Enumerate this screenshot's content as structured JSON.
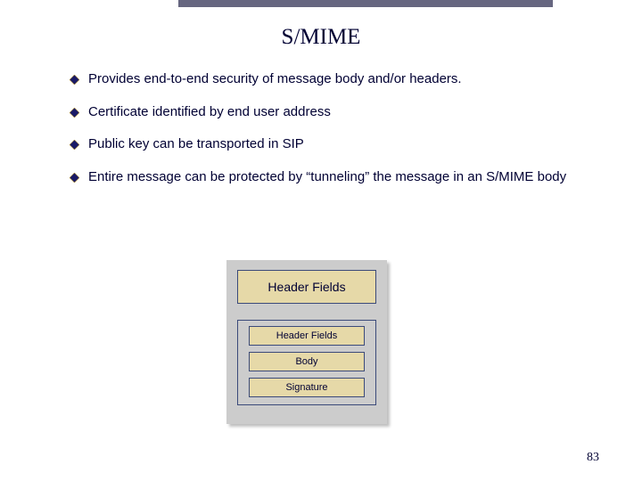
{
  "slide": {
    "title": "S/MIME",
    "bullets": [
      "Provides end-to-end security of message body and/or headers.",
      "Certificate identified by end user address",
      "Public key can be transported in SIP",
      "Entire message can be protected by “tunneling” the message in an S/MIME body"
    ],
    "diagram": {
      "outer": "Header Fields",
      "inner": [
        "Header Fields",
        "Body",
        "Signature"
      ]
    },
    "page_number": "83"
  }
}
